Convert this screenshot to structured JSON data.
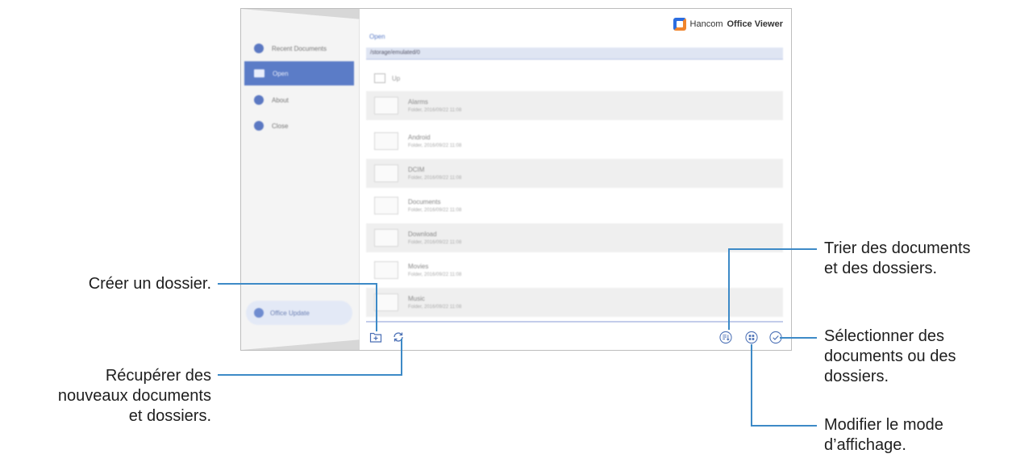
{
  "app": {
    "brand_prefix": "Hancom",
    "brand_name": "Office Viewer"
  },
  "sidebar": {
    "items": [
      {
        "label": "Recent Documents",
        "icon": "clock-icon",
        "active": false
      },
      {
        "label": "Open",
        "icon": "folder-icon",
        "active": true
      },
      {
        "label": "About",
        "icon": "info-icon",
        "active": false
      },
      {
        "label": "Close",
        "icon": "close-icon",
        "active": false
      }
    ],
    "update_label": "Office Update"
  },
  "browser": {
    "section_label": "Open",
    "path": "/storage/emulated/0",
    "up_label": "Up",
    "rows": [
      {
        "name": "Alarms",
        "meta": "Folder, 2016/09/22 11:08"
      },
      {
        "name": "Android",
        "meta": "Folder, 2016/09/22 11:08"
      },
      {
        "name": "DCIM",
        "meta": "Folder, 2016/09/22 11:08"
      },
      {
        "name": "Documents",
        "meta": "Folder, 2016/09/22 11:08"
      },
      {
        "name": "Download",
        "meta": "Folder, 2016/09/22 11:08"
      },
      {
        "name": "Movies",
        "meta": "Folder, 2016/09/22 11:08"
      },
      {
        "name": "Music",
        "meta": "Folder, 2016/09/22 11:08"
      }
    ]
  },
  "callouts": {
    "create_folder": "Créer un dossier.",
    "refresh_l1": "Récupérer des",
    "refresh_l2": "nouveaux documents",
    "refresh_l3": "et dossiers.",
    "sort_l1": "Trier des documents",
    "sort_l2": "et des dossiers.",
    "select_l1": "Sélectionner des",
    "select_l2": "documents ou des",
    "select_l3": "dossiers.",
    "view_l1": "Modifier le mode",
    "view_l2": "d’affichage."
  },
  "colors": {
    "accent": "#5b7cc7",
    "callout_line": "#3d8ac7"
  }
}
